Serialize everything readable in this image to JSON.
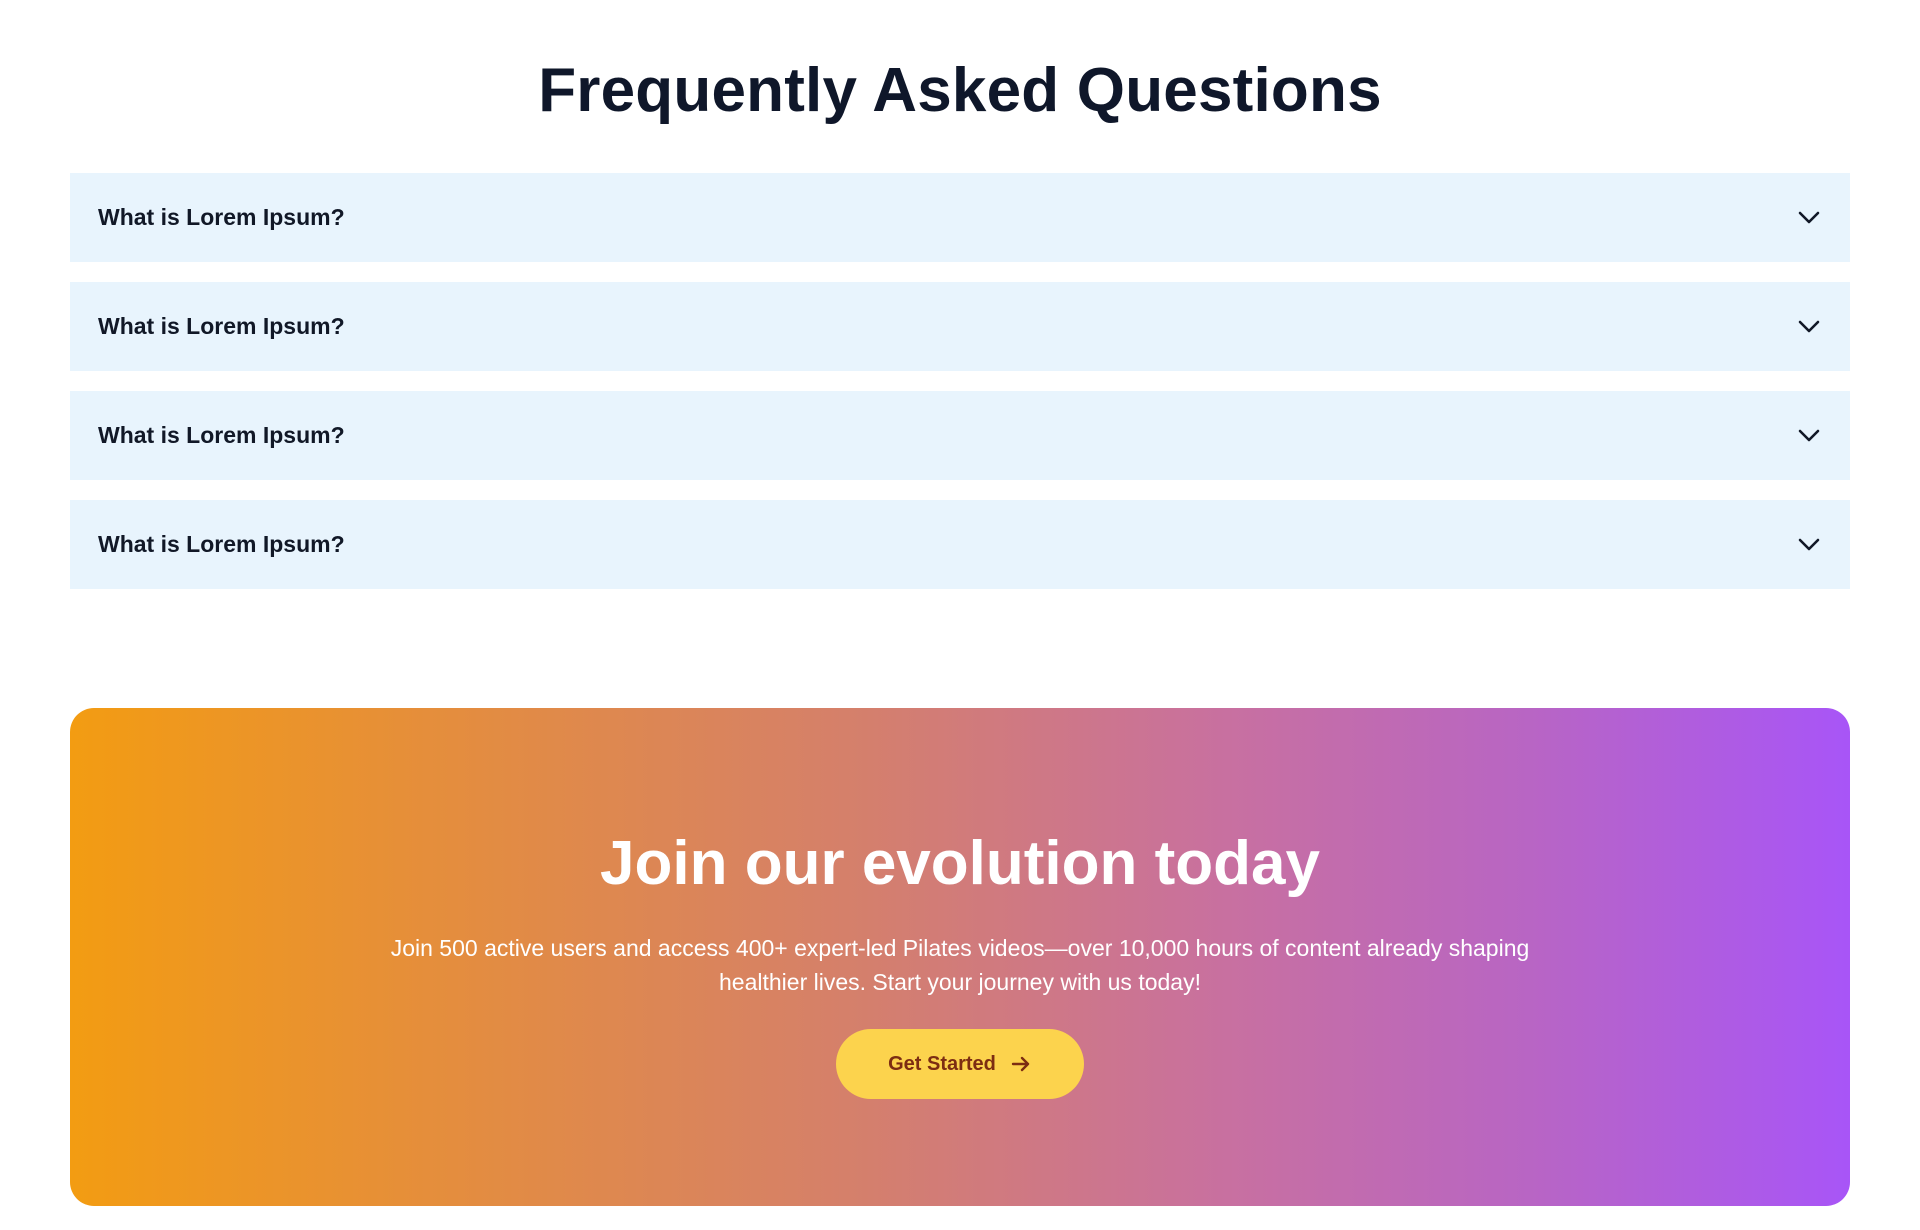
{
  "faq": {
    "title": "Frequently Asked Questions",
    "items": [
      {
        "question": "What is Lorem Ipsum?",
        "icon": "chevron-down-icon"
      },
      {
        "question": "What is Lorem Ipsum?",
        "icon": "chevron-down-icon"
      },
      {
        "question": "What is Lorem Ipsum?",
        "icon": "chevron-down-icon"
      },
      {
        "question": "What is Lorem Ipsum?",
        "icon": "chevron-down-icon"
      }
    ]
  },
  "cta": {
    "title": "Join our evolution today",
    "text": "Join 500 active users and access 400+ expert-led Pilates videos—over 10,000 hours of content already shaping healthier lives. Start your journey with us today!",
    "button_label": "Get Started",
    "button_icon": "arrow-right-icon",
    "gradient_start": "#f39c12",
    "gradient_end": "#a855f7",
    "button_color": "#fcd34d"
  },
  "colors": {
    "faq_item_bg": "#e8f4fd",
    "heading": "#0f172a"
  }
}
